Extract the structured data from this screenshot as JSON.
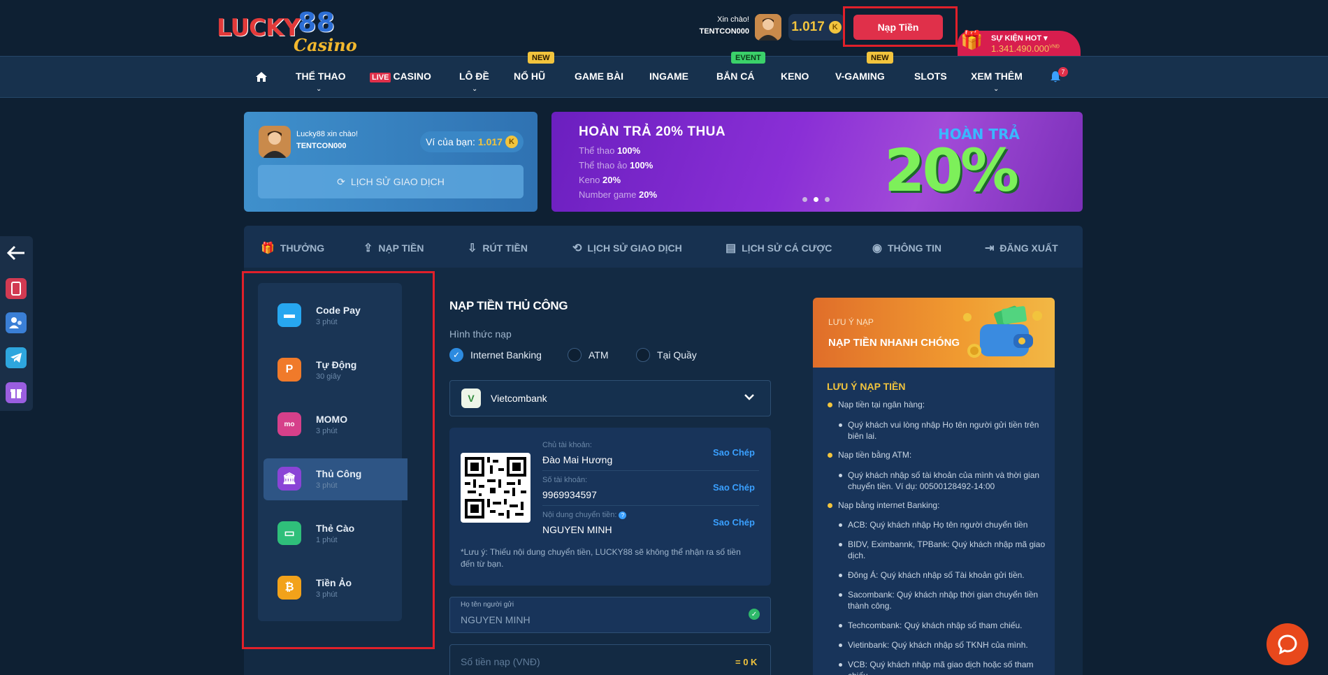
{
  "header": {
    "logo": {
      "word1": "LUCKY",
      "word2": "88",
      "word3": "Casino"
    },
    "greeting": "Xin chào!",
    "username": "TENTCON000",
    "balance": "1.017",
    "coin_symbol": "K",
    "deposit_label": "Nạp Tiền",
    "hot_event_title": "SỰ KIỆN HOT",
    "hot_event_amount": "1.341.490.000",
    "hot_event_unit": "VNĐ"
  },
  "nav": {
    "items": [
      {
        "label": "THỂ THAO",
        "has_dropdown": true
      },
      {
        "live": "LIVE",
        "label": "CASINO"
      },
      {
        "label": "LÔ ĐỀ",
        "has_dropdown": true
      },
      {
        "label": "NỔ HŨ",
        "badge": "NEW"
      },
      {
        "label": "GAME BÀI"
      },
      {
        "label": "INGAME"
      },
      {
        "label": "BẮN CÁ",
        "badge": "EVENT"
      },
      {
        "label": "KENO"
      },
      {
        "label": "V-GAMING",
        "badge": "NEW"
      },
      {
        "label": "SLOTS"
      },
      {
        "label": "XEM THÊM",
        "has_dropdown": true
      }
    ],
    "notification_count": "7"
  },
  "user_card": {
    "greeting": "Lucky88 xin chào!",
    "username": "TENTCON000",
    "wallet_label": "Ví của bạn:",
    "wallet_value": "1.017",
    "history_button": "LỊCH SỬ GIAO DỊCH"
  },
  "promo": {
    "title": "HOÀN TRẢ 20% THUA",
    "lines": [
      {
        "label": "Thể thao",
        "value": "100%"
      },
      {
        "label": "Thể thao ảo",
        "value": "100%"
      },
      {
        "label": "Keno",
        "value": "20%"
      },
      {
        "label": "Number game",
        "value": "20%"
      }
    ],
    "art_title": "HOÀN TRẢ",
    "art_big": "20%",
    "active_slide": 2,
    "slide_count": 3
  },
  "tabs": [
    {
      "label": "THƯỞNG",
      "icon": "gift-icon"
    },
    {
      "label": "NẠP TIỀN",
      "icon": "deposit-icon"
    },
    {
      "label": "RÚT TIỀN",
      "icon": "withdraw-icon"
    },
    {
      "label": "LỊCH SỬ GIAO DỊCH",
      "icon": "history-icon"
    },
    {
      "label": "LỊCH SỬ CÁ CƯỢC",
      "icon": "receipt-icon"
    },
    {
      "label": "THÔNG TIN",
      "icon": "user-icon"
    },
    {
      "label": "ĐĂNG XUẤT",
      "icon": "logout-icon"
    }
  ],
  "methods": [
    {
      "name": "Code Pay",
      "time": "3 phút",
      "color": "#27a7f0",
      "icon": "card-icon"
    },
    {
      "name": "Tự Động",
      "time": "30 giây",
      "color": "#f07a2a",
      "icon": "auto-icon"
    },
    {
      "name": "MOMO",
      "time": "3 phút",
      "color": "#d6408a",
      "icon": "momo-icon"
    },
    {
      "name": "Thủ Công",
      "time": "3 phút",
      "color": "#8a44d6",
      "icon": "bank-icon",
      "active": true
    },
    {
      "name": "Thẻ Cào",
      "time": "1 phút",
      "color": "#2fbf7a",
      "icon": "scratch-card-icon"
    },
    {
      "name": "Tiền Ảo",
      "time": "3 phút",
      "color": "#f2a21a",
      "icon": "bitcoin-icon"
    }
  ],
  "form": {
    "title": "NẠP TIỀN THỦ CÔNG",
    "method_label": "Hình thức nạp",
    "options": [
      {
        "label": "Internet Banking",
        "selected": true
      },
      {
        "label": "ATM",
        "selected": false
      },
      {
        "label": "Tại Quầy",
        "selected": false
      }
    ],
    "bank": "Vietcombank",
    "account_holder_label": "Chủ tài khoản:",
    "account_holder": "Đào Mai Hương",
    "account_number_label": "Số tài khoản:",
    "account_number": "9969934597",
    "transfer_note_label": "Nội dung chuyển tiền:",
    "transfer_note": "NGUYEN MINH",
    "copy_label": "Sao Chép",
    "warning": "*Lưu ý: Thiếu nội dung chuyển tiền, LUCKY88 sẽ không thể nhận ra số tiền đến từ bạn.",
    "sender_label": "Họ tên người gửi",
    "sender_value": "NGUYEN MINH",
    "amount_placeholder": "Số tiền nạp (VNĐ)",
    "amount_converted": "= 0 K"
  },
  "notes": {
    "banner_sub": "LƯU Ý NẠP",
    "banner_title": "NẠP TIỀN NHANH CHÓNG",
    "heading": "LƯU Ý NẠP TIỀN",
    "items": [
      {
        "level": 1,
        "text": "Nạp tiền tại ngân hàng:"
      },
      {
        "level": 2,
        "text": "Quý khách vui lòng nhập Họ tên người gửi tiền trên biên lai."
      },
      {
        "level": 1,
        "text": "Nạp tiền bằng ATM:"
      },
      {
        "level": 2,
        "text": "Quý khách nhập số tài khoản của mình và thời gian chuyển tiền. Ví dụ: 00500128492-14:00"
      },
      {
        "level": 1,
        "text": "Nạp bằng internet Banking:"
      },
      {
        "level": 2,
        "text": "ACB: Quý khách nhập Họ tên người chuyển tiền"
      },
      {
        "level": 2,
        "text": "BIDV, Eximbannk, TPBank: Quý khách nhập mã giao dịch."
      },
      {
        "level": 2,
        "text": "Đông Á: Quý khách nhập số Tài khoản gửi tiền."
      },
      {
        "level": 2,
        "text": "Sacombank: Quý khách nhập thời gian chuyển tiền thành công."
      },
      {
        "level": 2,
        "text": "Techcombank: Quý khách nhập số tham chiếu."
      },
      {
        "level": 2,
        "text": "Vietinbank: Quý khách nhập số TKNH của mình."
      },
      {
        "level": 2,
        "text": "VCB: Quý khách nhập mã giao dịch hoặc số tham chiếu."
      }
    ]
  },
  "left_float": [
    "back-arrow-icon",
    "phone-icon",
    "users-icon",
    "telegram-icon",
    "gift-icon"
  ],
  "colors": {
    "accent": "#e0304a",
    "gold": "#f2c43d",
    "link": "#3aa0ff",
    "highlight_border": "#e0202a"
  }
}
